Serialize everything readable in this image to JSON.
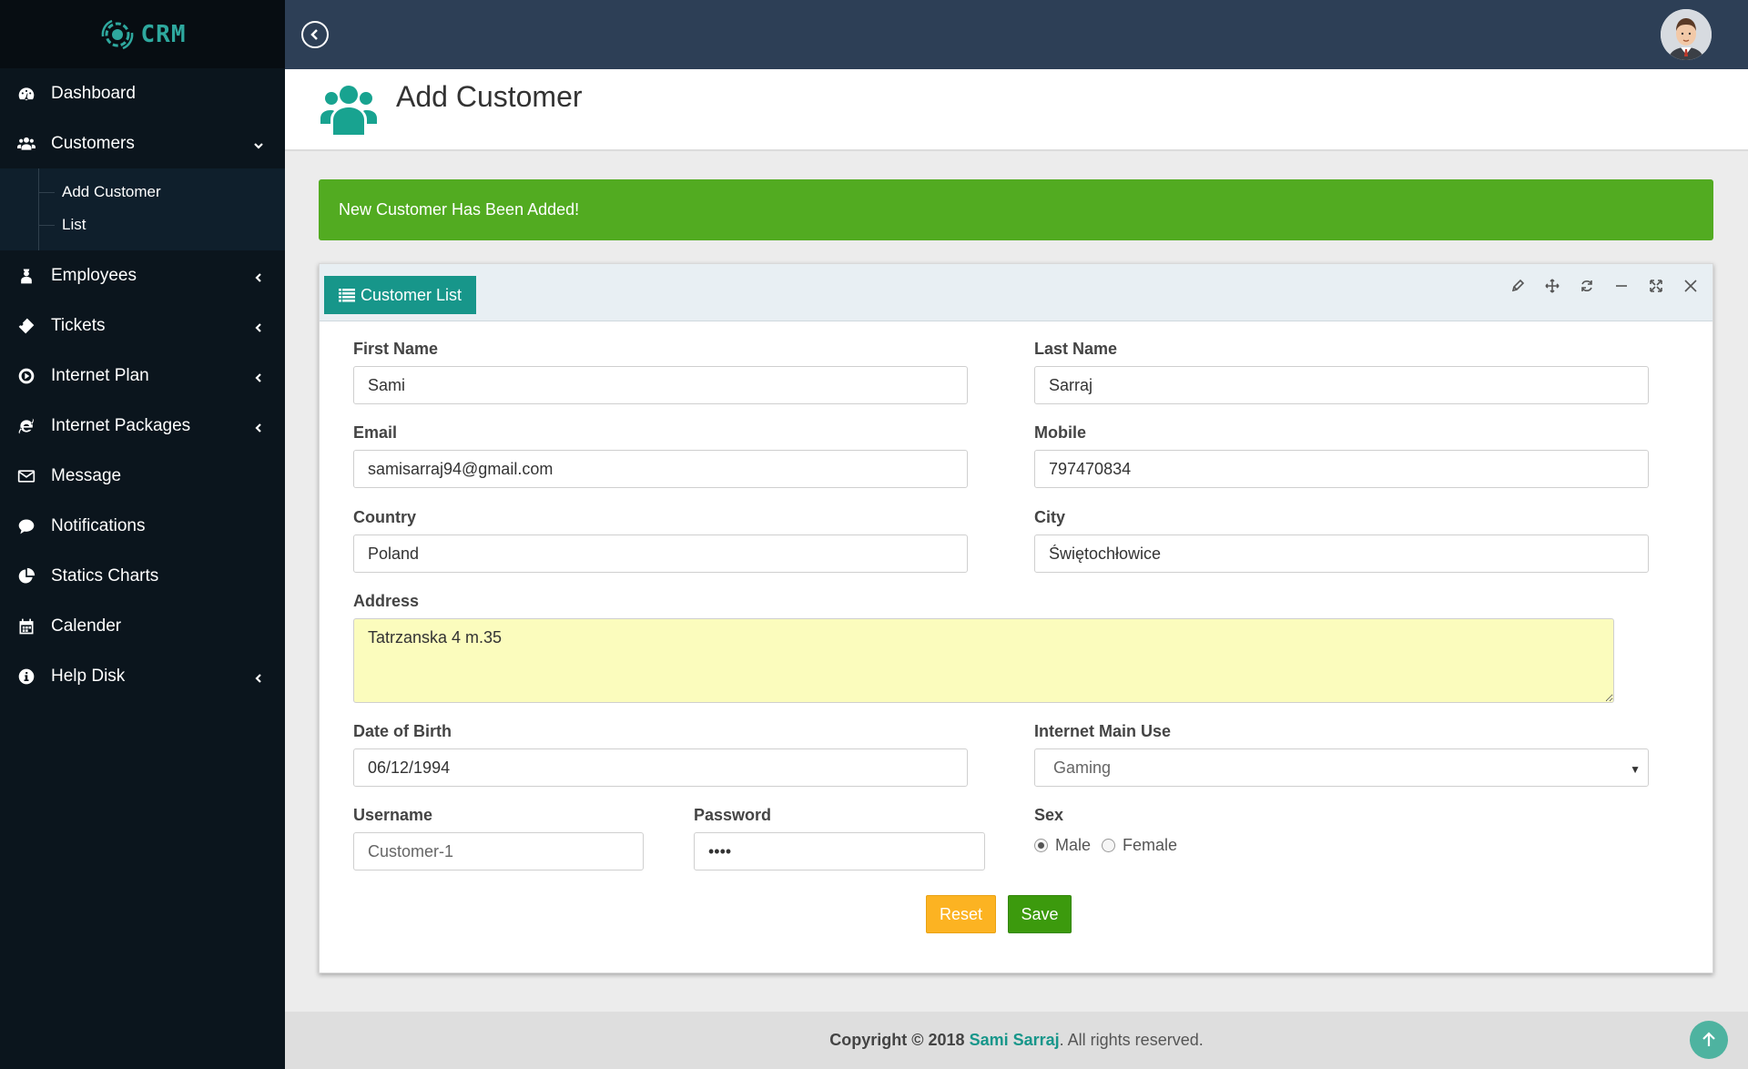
{
  "sidebar": {
    "logo_text": "CRM",
    "items": [
      {
        "label": "Dashboard",
        "icon": "dashboard-icon"
      },
      {
        "label": "Customers",
        "icon": "users-icon",
        "expanded": true,
        "submenu": [
          {
            "label": "Add Customer"
          },
          {
            "label": "List"
          }
        ]
      },
      {
        "label": "Employees",
        "icon": "user-tie-icon"
      },
      {
        "label": "Tickets",
        "icon": "ticket-icon"
      },
      {
        "label": "Internet Plan",
        "icon": "circle-arrow-icon"
      },
      {
        "label": "Internet Packages",
        "icon": "internet-explorer-icon"
      },
      {
        "label": "Message",
        "icon": "envelope-icon"
      },
      {
        "label": "Notifications",
        "icon": "comment-icon"
      },
      {
        "label": "Statics Charts",
        "icon": "pie-chart-icon"
      },
      {
        "label": "Calender",
        "icon": "calendar-icon"
      },
      {
        "label": "Help Disk",
        "icon": "info-icon"
      }
    ]
  },
  "header": {
    "title": "Add Customer",
    "icon": "users-icon"
  },
  "alert": {
    "text": "New Customer Has Been Added!",
    "color": "#52ab21"
  },
  "panel": {
    "tab_label": "Customer List",
    "tools": [
      "pencil-icon",
      "move-icon",
      "refresh-icon",
      "minimize-icon",
      "expand-icon",
      "close-icon"
    ]
  },
  "form": {
    "first_name": {
      "label": "First Name",
      "value": "Sami"
    },
    "last_name": {
      "label": "Last Name",
      "value": "Sarraj"
    },
    "email": {
      "label": "Email",
      "value": "samisarraj94@gmail.com"
    },
    "mobile": {
      "label": "Mobile",
      "value": "797470834"
    },
    "country": {
      "label": "Country",
      "value": "Poland"
    },
    "city": {
      "label": "City",
      "value": "Świętochłowice"
    },
    "address": {
      "label": "Address",
      "value": "Tatrzanska 4 m.35"
    },
    "dob": {
      "label": "Date of Birth",
      "value": "06/12/1994"
    },
    "internet_use": {
      "label": "Internet Main Use",
      "value": "Gaming"
    },
    "username": {
      "label": "Username",
      "value": "Customer-1"
    },
    "password": {
      "label": "Password",
      "value": "••••"
    },
    "sex": {
      "label": "Sex",
      "options": [
        "Male",
        "Female"
      ],
      "selected": "Male"
    },
    "reset_label": "Reset",
    "save_label": "Save"
  },
  "footer": {
    "copyright": "Copyright © 2018",
    "author": "Sami Sarraj",
    "rest": ". All rights reserved."
  },
  "colors": {
    "sidebar": "#0b151d",
    "topbar": "#2d3f56",
    "accent": "#17968a",
    "reset": "#fcb322",
    "save": "#3c9a0d"
  }
}
